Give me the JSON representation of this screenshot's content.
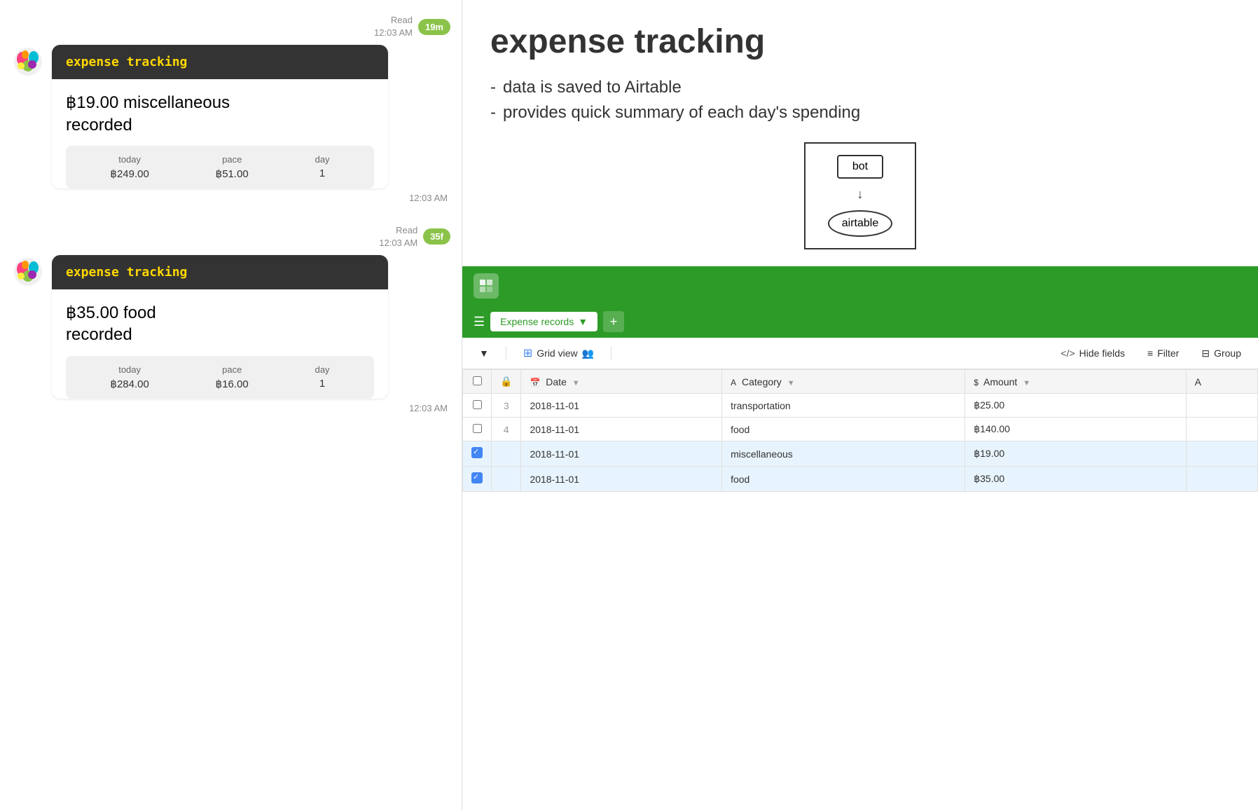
{
  "chat": {
    "messages": [
      {
        "id": "msg1",
        "read_text": "Read\n12:03 AM",
        "time_badge": "19m",
        "title": "expense tracking",
        "amount": "฿19.00 miscellaneous\nrecorded",
        "stats": {
          "today_label": "today",
          "today_value": "฿249.00",
          "pace_label": "pace",
          "pace_value": "฿51.00",
          "day_label": "day",
          "day_value": "1"
        },
        "timestamp": "12:03 AM"
      },
      {
        "id": "msg2",
        "read_text": "Read\n12:03 AM",
        "time_badge": "35f",
        "title": "expense tracking",
        "amount": "฿35.00 food\nrecorded",
        "stats": {
          "today_label": "today",
          "today_value": "฿284.00",
          "pace_label": "pace",
          "pace_value": "฿16.00",
          "day_label": "day",
          "day_value": "1"
        },
        "timestamp": "12:03 AM"
      }
    ]
  },
  "description": {
    "title": "expense tracking",
    "bullet1": "data is saved to Airtable",
    "bullet2": "provides quick summary of each day's spending"
  },
  "diagram": {
    "node1": "bot",
    "node2": "airtable"
  },
  "airtable": {
    "tab_name": "Expense records",
    "view_name": "Grid view",
    "hide_fields": "Hide fields",
    "filter": "Filter",
    "group": "Group",
    "columns": {
      "date": "Date",
      "category": "Category",
      "amount": "Amount"
    },
    "rows": [
      {
        "row_num": "3",
        "date": "2018-11-01",
        "category": "transportation",
        "amount": "฿25.00",
        "checked": false,
        "highlight": false
      },
      {
        "row_num": "4",
        "date": "2018-11-01",
        "category": "food",
        "amount": "฿140.00",
        "checked": false,
        "highlight": false
      },
      {
        "row_num": "",
        "date": "2018-11-01",
        "category": "miscellaneous",
        "amount": "฿19.00",
        "checked": true,
        "highlight": true
      },
      {
        "row_num": "",
        "date": "2018-11-01",
        "category": "food",
        "amount": "฿35.00",
        "checked": true,
        "highlight": true
      }
    ]
  }
}
